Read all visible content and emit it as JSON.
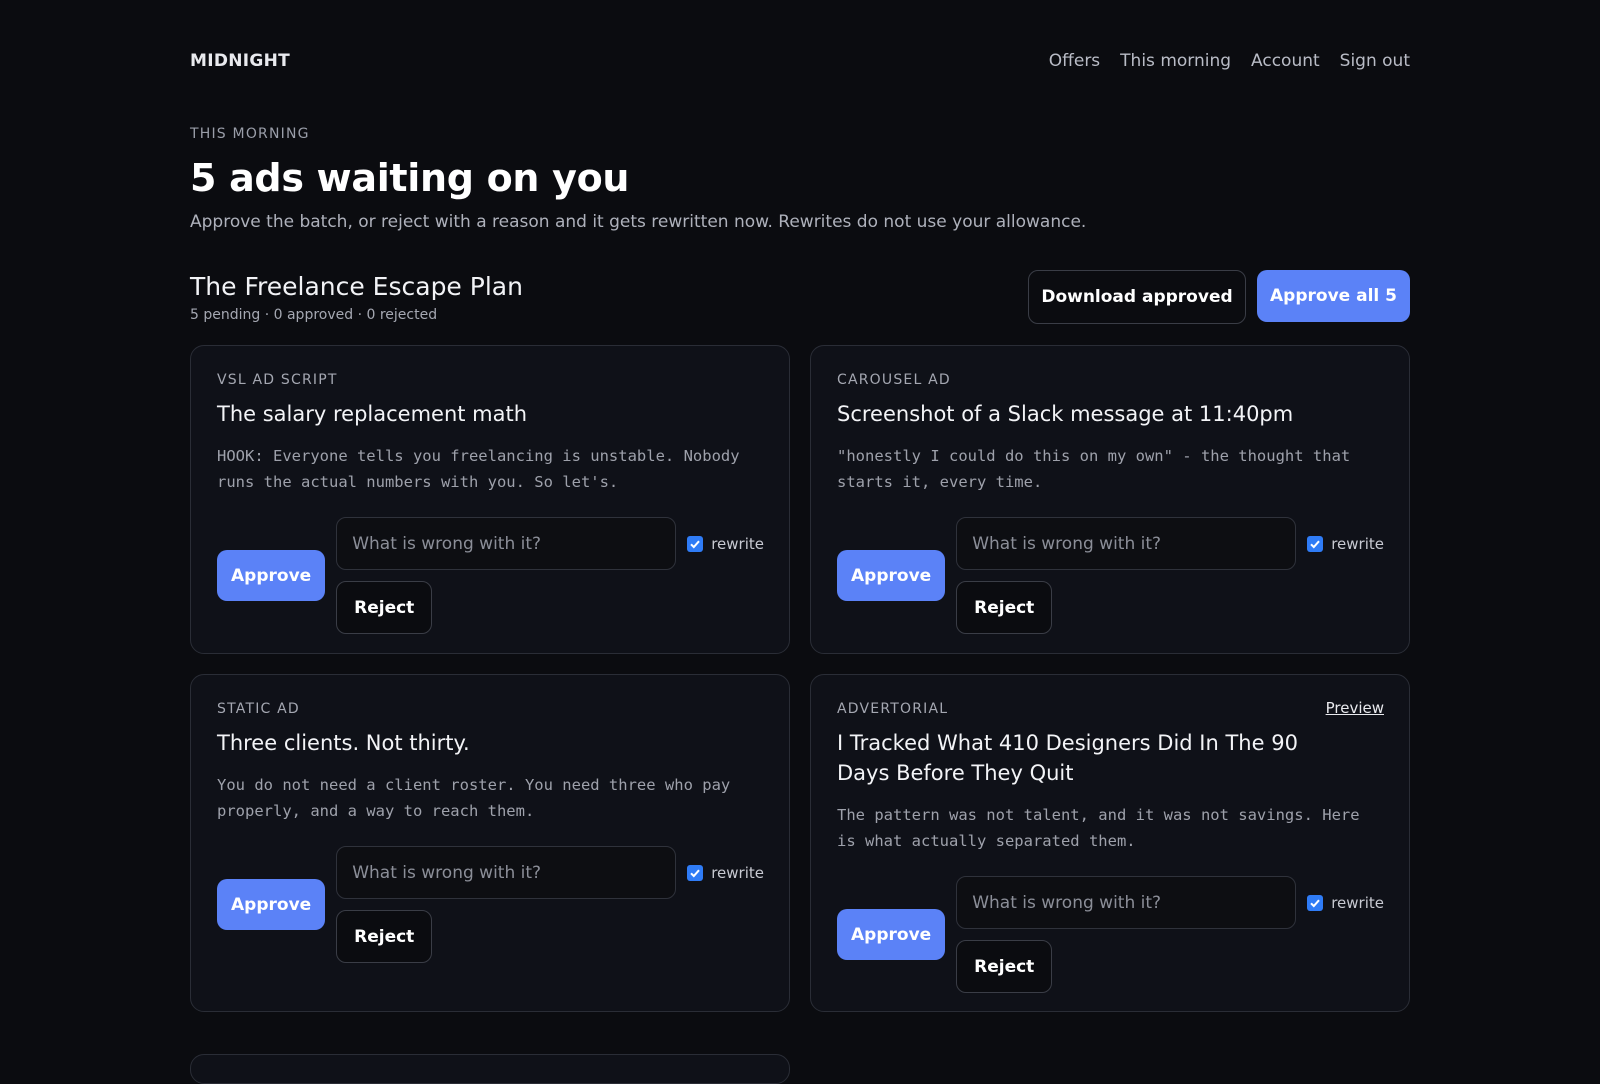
{
  "nav": {
    "brand": "MIDNIGHT",
    "links": [
      "Offers",
      "This morning",
      "Account",
      "Sign out"
    ]
  },
  "header": {
    "eyebrow": "THIS MORNING",
    "title": "5 ads waiting on you",
    "subtitle": "Approve the batch, or reject with a reason and it gets rewritten now. Rewrites do not use your allowance."
  },
  "batch": {
    "name": "The Freelance Escape Plan",
    "stats": "5 pending · 0 approved · 0 rejected",
    "download_label": "Download approved",
    "approve_all_label": "Approve all 5"
  },
  "card_common": {
    "approve_label": "Approve",
    "reject_label": "Reject",
    "reason_placeholder": "What is wrong with it?",
    "rewrite_label": "rewrite",
    "preview_label": "Preview"
  },
  "cards": [
    {
      "type": "VSL AD SCRIPT",
      "title": "The salary replacement math",
      "body": "HOOK: Everyone tells you freelancing is unstable. Nobody runs the actual numbers with you. So let's.",
      "rewrite_checked": true
    },
    {
      "type": "CAROUSEL AD",
      "title": "Screenshot of a Slack message at 11:40pm",
      "body": "\"honestly I could do this on my own\" - the thought that starts it, every time.",
      "rewrite_checked": true
    },
    {
      "type": "STATIC AD",
      "title": "Three clients. Not thirty.",
      "body": "You do not need a client roster. You need three who pay properly, and a way to reach them.",
      "rewrite_checked": true
    },
    {
      "type": "ADVERTORIAL",
      "title": "I Tracked What 410 Designers Did In The 90 Days Before They Quit",
      "body": "The pattern was not talent, and it was not savings. Here is what actually separated them.",
      "rewrite_checked": true,
      "has_preview": true
    }
  ],
  "colors": {
    "background": "#0b0c10",
    "card": "#0f1118",
    "accent": "#5b82f7",
    "checkbox": "#2f7cf6"
  }
}
